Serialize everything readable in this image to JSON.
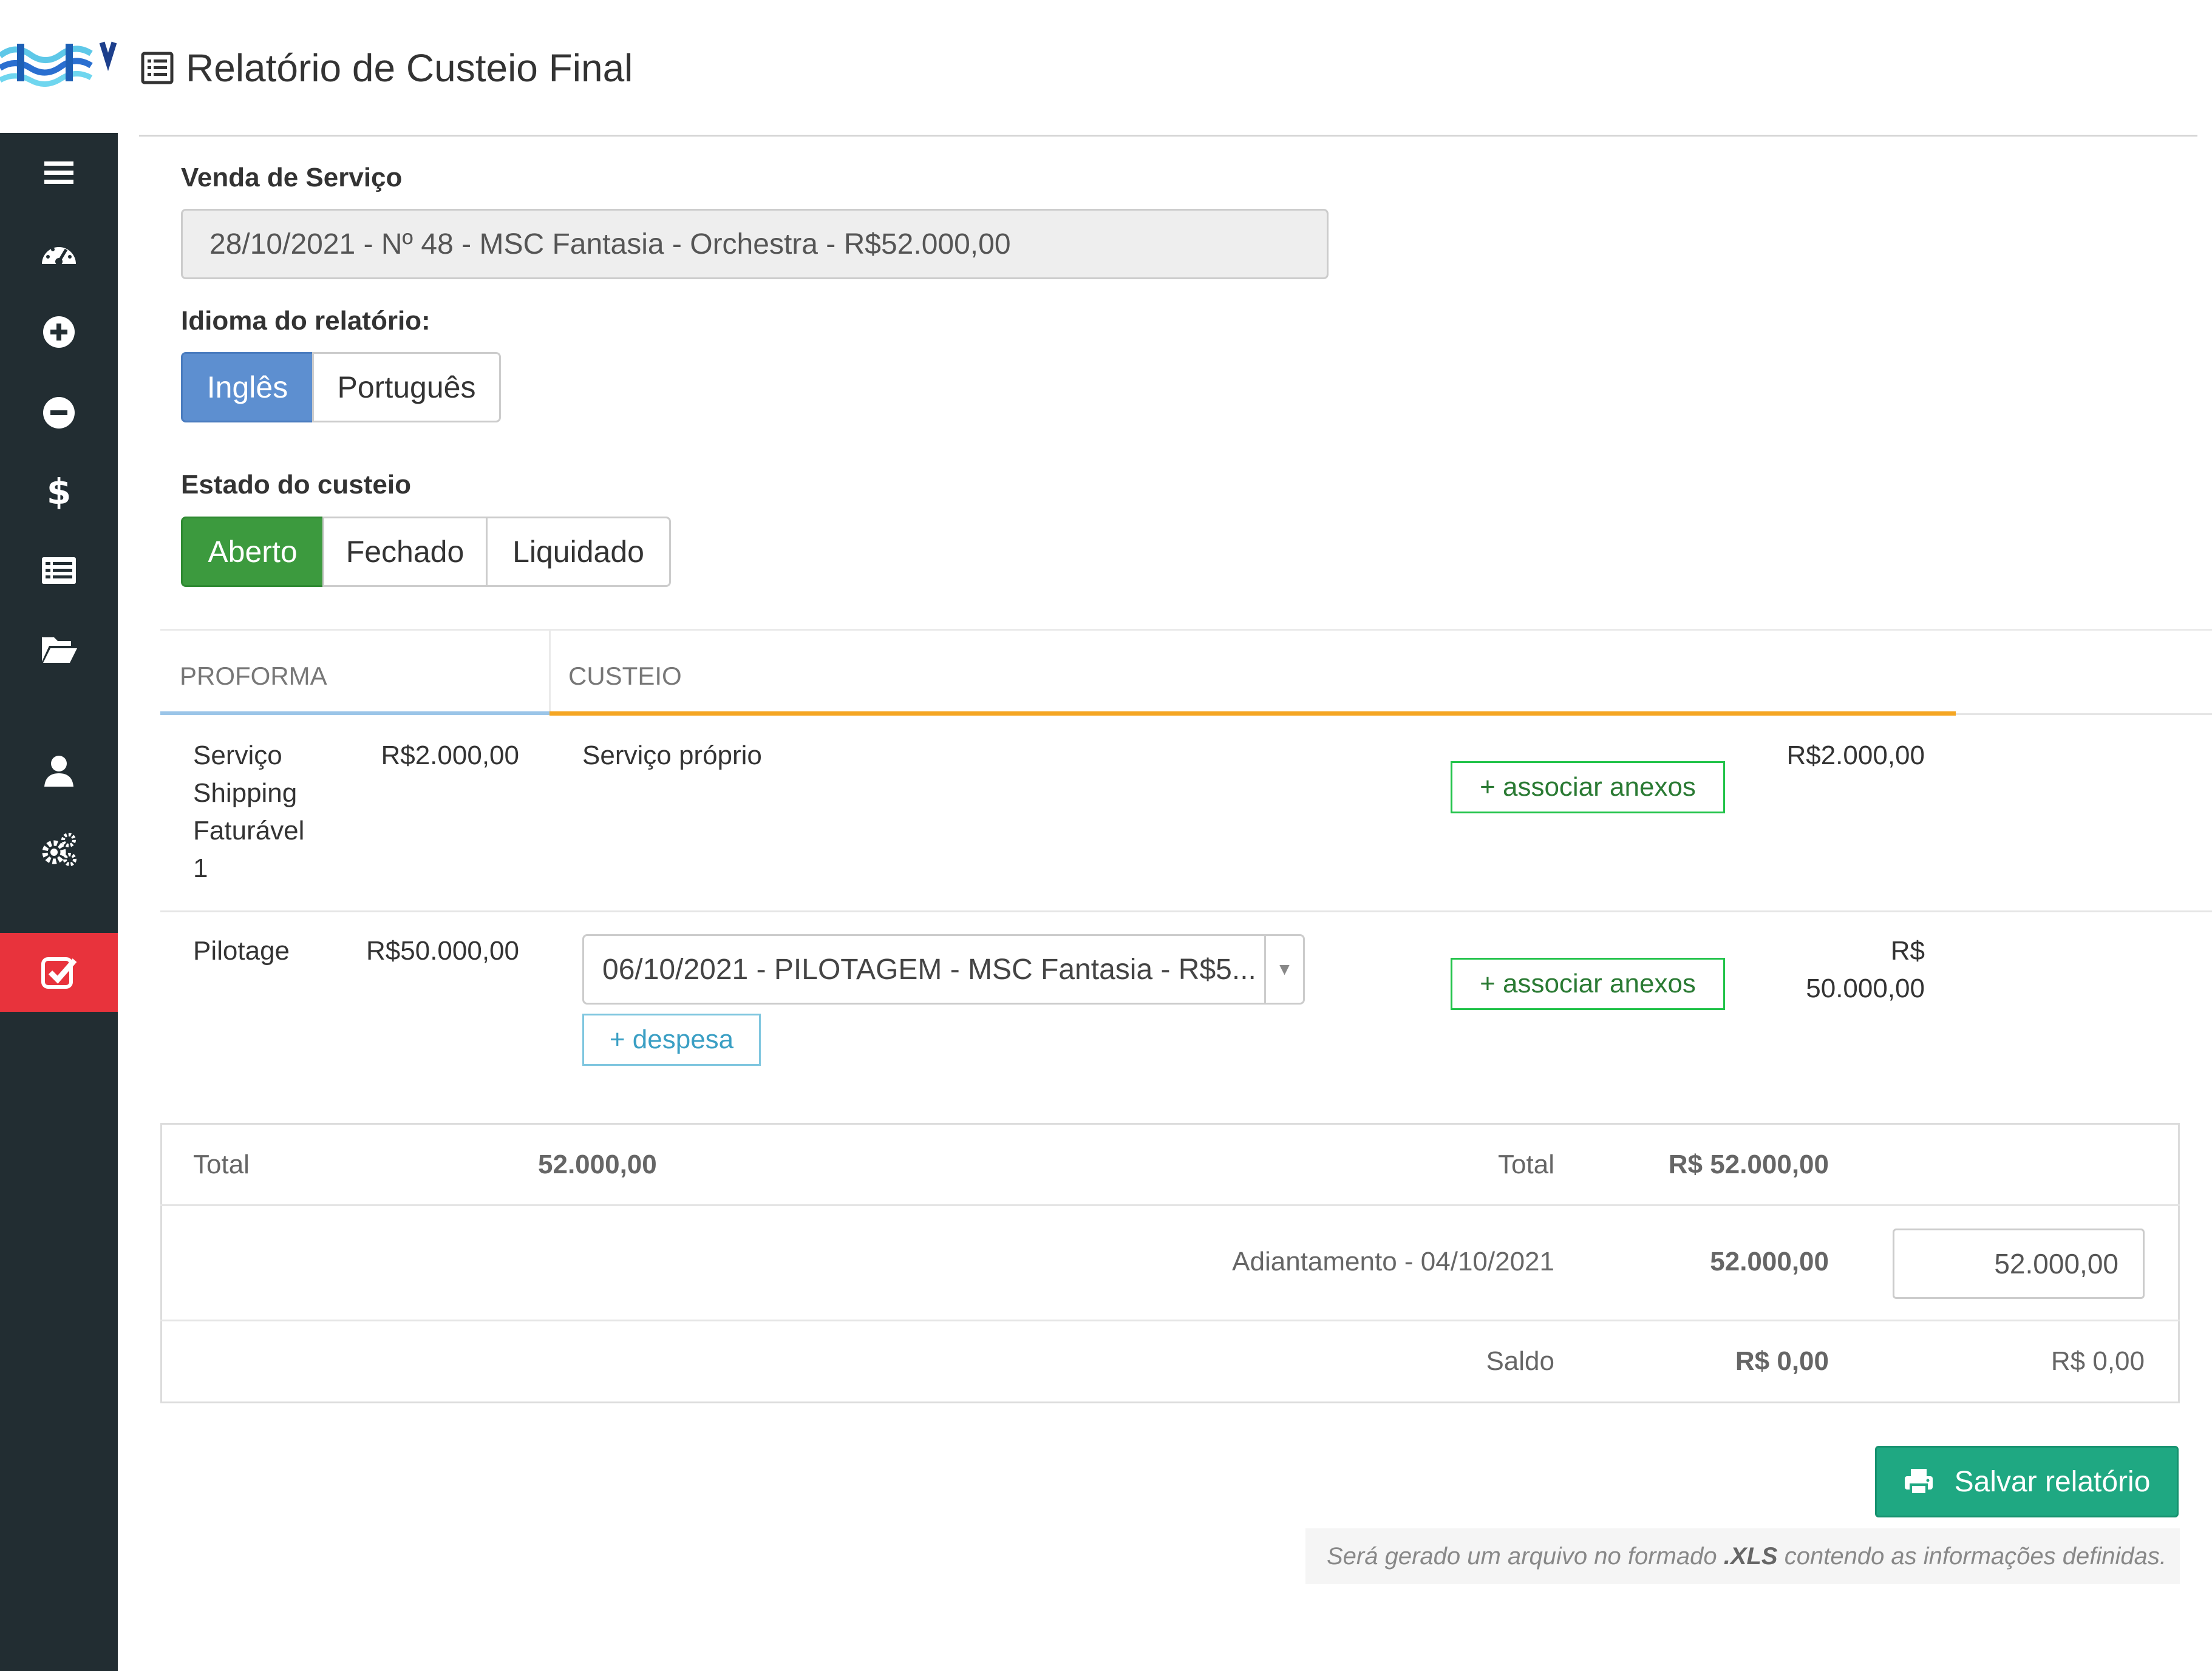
{
  "page": {
    "title": "Relatório de Custeio Final"
  },
  "sidebar": {
    "items": [
      {
        "icon": "menu-icon"
      },
      {
        "icon": "dashboard-icon"
      },
      {
        "icon": "plus-circle-icon"
      },
      {
        "icon": "minus-circle-icon"
      },
      {
        "icon": "dollar-icon"
      },
      {
        "icon": "list-card-icon"
      },
      {
        "icon": "folder-open-icon"
      },
      {
        "icon": "user-icon"
      },
      {
        "icon": "gears-icon"
      },
      {
        "icon": "check-square-icon",
        "active": true
      }
    ],
    "active_color": "#e8333c",
    "bg_color": "#222d32"
  },
  "form": {
    "service_label": "Venda de Serviço",
    "service_value": "28/10/2021 - Nº 48 - MSC Fantasia - Orchestra - R$52.000,00",
    "language_label": "Idioma do relatório:",
    "language_options": [
      "Inglês",
      "Português"
    ],
    "language_selected": "Inglês",
    "state_label": "Estado do custeio",
    "state_options": [
      "Aberto",
      "Fechado",
      "Liquidado"
    ],
    "state_selected": "Aberto"
  },
  "tabs": {
    "proforma": "PROFORMA",
    "custeio": "CUSTEIO"
  },
  "rows": [
    {
      "proforma_name_lines": [
        "Serviço",
        "Shipping",
        "Faturável",
        "1"
      ],
      "proforma_value": "R$2.000,00",
      "custeio_desc": "Serviço próprio",
      "attach_label": "+ associar anexos",
      "custeio_value": "R$2.000,00"
    },
    {
      "proforma_name": "Pilotage",
      "proforma_value": "R$50.000,00",
      "expense_select": "06/10/2021 - PILOTAGEM - MSC Fantasia - R$5...",
      "add_expense_label": "+ despesa",
      "attach_label": "+ associar anexos",
      "custeio_value_lines": [
        "R$",
        "50.000,00"
      ]
    }
  ],
  "totals": {
    "proforma_total_label": "Total",
    "proforma_total_value": "52.000,00",
    "custeio_total_label": "Total",
    "custeio_total_value": "R$ 52.000,00",
    "advance_label": "Adiantamento - 04/10/2021",
    "advance_value": "52.000,00",
    "advance_input": "52.000,00",
    "balance_label": "Saldo",
    "balance_value": "R$ 0,00",
    "balance_right": "R$ 0,00"
  },
  "actions": {
    "save_label": "Salvar relatório",
    "note_prefix": "Será gerado um arquivo no formado ",
    "note_ext": ".XLS",
    "note_suffix": " contendo as informações definidas."
  }
}
